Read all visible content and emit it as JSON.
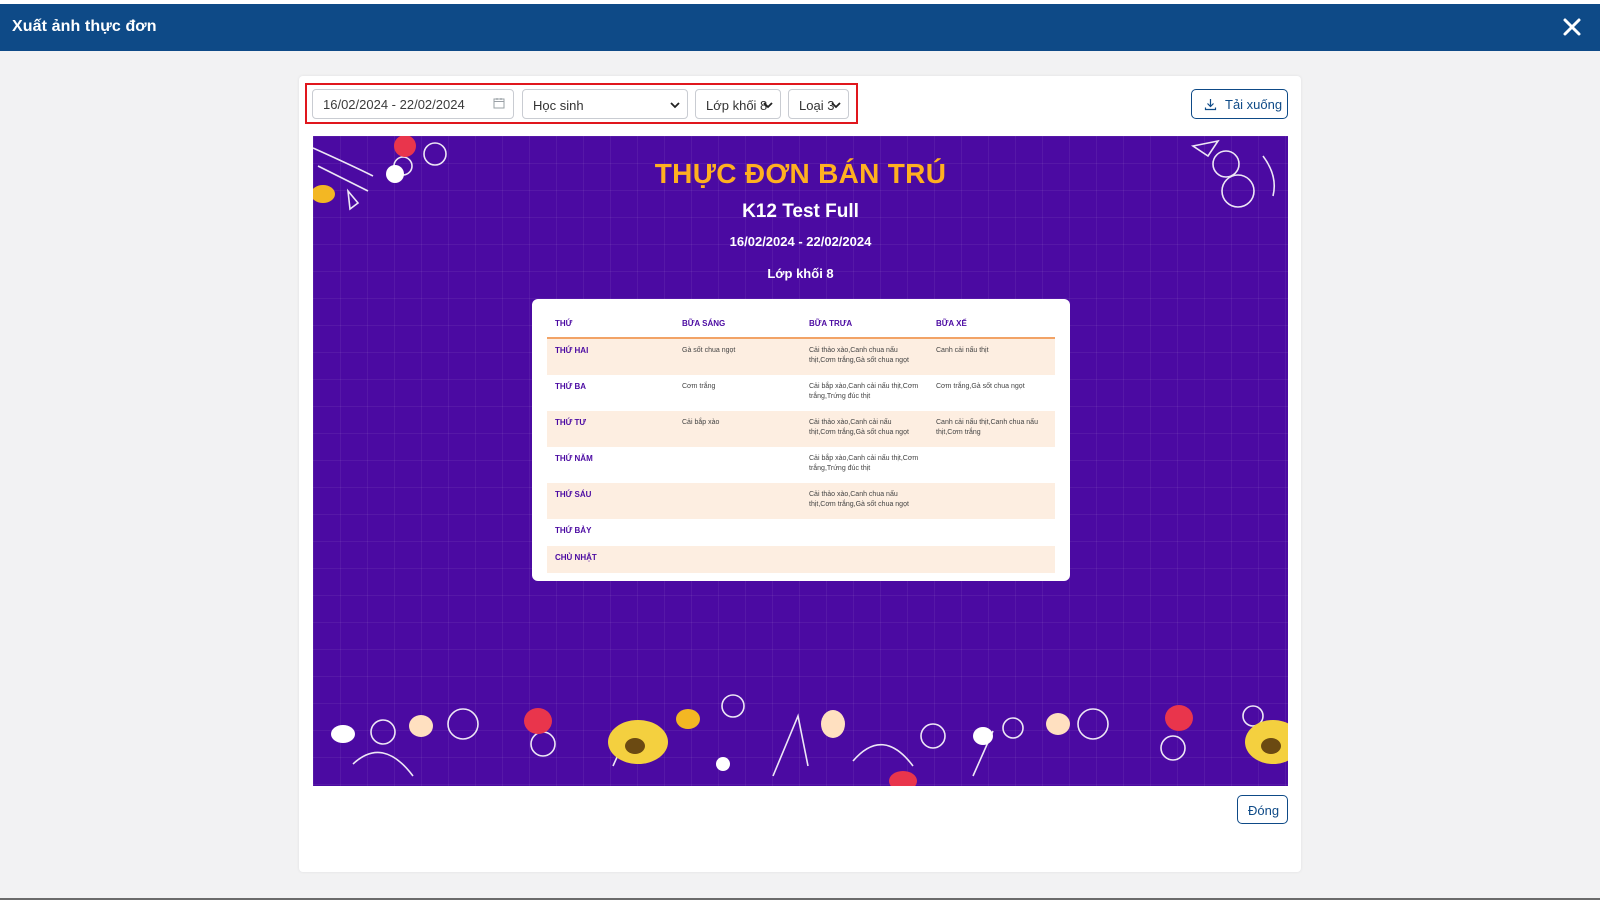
{
  "dialog": {
    "title": "Xuất ảnh thực đơn",
    "close_icon": "close-icon"
  },
  "filters": {
    "date_range": "16/02/2024 - 22/02/2024",
    "audience": "Học sinh",
    "grade": "Lớp khối 8",
    "type": "Loại 3"
  },
  "actions": {
    "download_label": "Tải xuống",
    "close_label": "Đóng"
  },
  "poster": {
    "heading": "THỰC ĐƠN BÁN TRÚ",
    "school": "K12 Test Full",
    "date_range": "16/02/2024 - 22/02/2024",
    "grade": "Lớp khối 8",
    "columns": [
      "THỨ",
      "BỮA SÁNG",
      "BỮA TRƯA",
      "BỮA XẾ"
    ],
    "rows": [
      {
        "day": "THỨ HAI",
        "breakfast": "Gà sốt chua ngọt",
        "lunch": "Cải thảo xào,Canh chua nấu thịt,Cơm trắng,Gà sốt chua ngọt",
        "snack": "Canh cải nấu thịt"
      },
      {
        "day": "THỨ BA",
        "breakfast": "Cơm trắng",
        "lunch": "Cải bắp xào,Canh cải nấu thịt,Cơm trắng,Trứng đúc thịt",
        "snack": "Cơm trắng,Gà sốt chua ngọt"
      },
      {
        "day": "THỨ TƯ",
        "breakfast": "Cải bắp xào",
        "lunch": "Cải thảo xào,Canh cải nấu thịt,Cơm trắng,Gà sốt chua ngọt",
        "snack": "Canh cải nấu thịt,Canh chua nấu thịt,Cơm trắng"
      },
      {
        "day": "THỨ NĂM",
        "breakfast": "",
        "lunch": "Cải bắp xào,Canh cải nấu thịt,Cơm trắng,Trứng đúc thịt",
        "snack": ""
      },
      {
        "day": "THỨ SÁU",
        "breakfast": "",
        "lunch": "Cải thảo xào,Canh chua nấu thịt,Cơm trắng,Gà sốt chua ngọt",
        "snack": ""
      },
      {
        "day": "THỨ BẢY",
        "breakfast": "",
        "lunch": "",
        "snack": ""
      },
      {
        "day": "CHỦ NHẬT",
        "breakfast": "",
        "lunch": "",
        "snack": ""
      }
    ]
  },
  "colors": {
    "header_bar": "#0e4a87",
    "poster_bg": "#4b0aa2",
    "poster_heading": "#ffb020",
    "highlight_border": "#e0171d",
    "row_alt": "#fdeee1"
  },
  "icons": [
    "close-icon",
    "calendar-icon",
    "chevron-down-icon",
    "download-icon"
  ]
}
